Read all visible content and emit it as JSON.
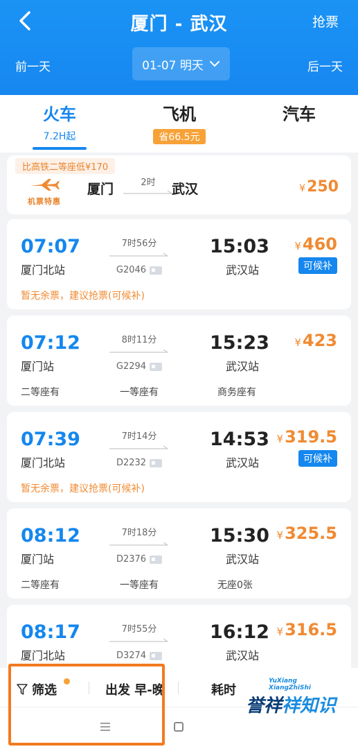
{
  "header": {
    "title": "厦门 - 武汉",
    "grab_label": "抢票",
    "prev_day": "前一天",
    "next_day": "后一天",
    "date": "01-07 明天"
  },
  "tabs": [
    {
      "label": "火车",
      "sub": "7.2H起"
    },
    {
      "label": "飞机",
      "sub": "省66.5元"
    },
    {
      "label": "汽车",
      "sub": ""
    }
  ],
  "promo": {
    "banner": "比高铁二等座低¥170",
    "logo_text": "机票特惠",
    "from": "厦门",
    "to": "武汉",
    "duration": "2时",
    "currency": "¥",
    "price": "250"
  },
  "trains": [
    {
      "dep_time": "07:07",
      "dep_station": "厦门北站",
      "duration": "7时56分",
      "code": "G2046",
      "arr_time": "15:03",
      "arr_station": "武汉站",
      "currency": "¥",
      "price": "460",
      "waitlist": "可候补",
      "note": "暂无余票，建议抢票(可候补)",
      "seats": []
    },
    {
      "dep_time": "07:12",
      "dep_station": "厦门站",
      "duration": "8时11分",
      "code": "G2294",
      "arr_time": "15:23",
      "arr_station": "武汉站",
      "currency": "¥",
      "price": "423",
      "waitlist": "",
      "note": "",
      "seats": [
        "二等座有",
        "一等座有",
        "商务座有"
      ]
    },
    {
      "dep_time": "07:39",
      "dep_station": "厦门北站",
      "duration": "7时14分",
      "code": "D2232",
      "arr_time": "14:53",
      "arr_station": "武汉站",
      "currency": "¥",
      "price": "319.5",
      "waitlist": "可候补",
      "note": "暂无余票，建议抢票(可候补)",
      "seats": []
    },
    {
      "dep_time": "08:12",
      "dep_station": "厦门站",
      "duration": "7时18分",
      "code": "D2376",
      "arr_time": "15:30",
      "arr_station": "武汉站",
      "currency": "¥",
      "price": "325.5",
      "waitlist": "",
      "note": "",
      "seats": [
        "二等座有",
        "一等座有",
        "无座0张"
      ]
    },
    {
      "dep_time": "08:17",
      "dep_station": "厦门北站",
      "duration": "7时55分",
      "code": "D3274",
      "arr_time": "16:12",
      "arr_station": "武汉站",
      "currency": "¥",
      "price": "316.5",
      "waitlist": "",
      "note": "",
      "seats": []
    }
  ],
  "filters": {
    "filter_label": "筛选",
    "depart_label": "出发 早-晚",
    "duration_label": "耗时"
  },
  "watermark": {
    "en_line1": "YuXiang",
    "en_line2": "XiangZhiShi",
    "cn_part1": "誉祥",
    "cn_part2": "祥知识"
  },
  "colors": {
    "header_blue": "#1787f0",
    "accent_blue": "#1587ee",
    "price_orange": "#f08a32",
    "highlight_orange": "#f37a1f"
  }
}
